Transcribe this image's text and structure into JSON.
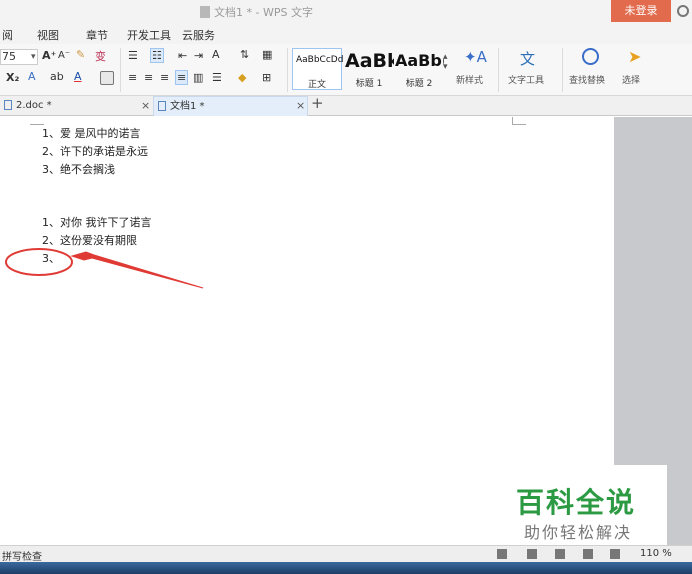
{
  "titlebar": {
    "title": "文档1 * - WPS 文字",
    "login": "未登录"
  },
  "menu": {
    "items": [
      "阅",
      "视图",
      "章节",
      "开发工具",
      "云服务"
    ]
  },
  "ribbon": {
    "font_size": "75",
    "styles": [
      {
        "sample": "AaBbCcDd",
        "label": "正文"
      },
      {
        "sample": "AaBk",
        "label": "标题 1"
      },
      {
        "sample": "AaBb(",
        "label": "标题 2"
      }
    ],
    "new_style": "新样式",
    "text_tools": "文字工具",
    "find_replace": "查找替换",
    "select": "选择"
  },
  "tabs": [
    {
      "label": "2.doc *"
    },
    {
      "label": "文档1 *"
    }
  ],
  "document": {
    "list1": [
      "1、爱 是风中的诺言",
      "2、许下的承诺是永远",
      "3、绝不会搁浅"
    ],
    "list2": [
      "1、对你 我许下了诺言",
      "2、这份爱没有期限",
      "3、"
    ]
  },
  "watermark": {
    "title": "百科全说",
    "subtitle": "助你轻松解决"
  },
  "statusbar": {
    "spellcheck": "拼写检查",
    "zoom": "110 %"
  },
  "colors": {
    "login_bg": "#e26b4d",
    "annotation": "#e03a35",
    "watermark_green": "#2b9a42"
  }
}
